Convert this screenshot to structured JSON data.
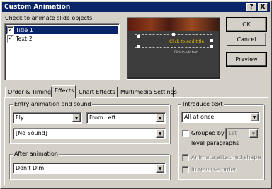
{
  "window": {
    "title": "Custom Animation"
  },
  "titlebar_buttons": {
    "help": "?",
    "close": "X"
  },
  "objects": {
    "label": "Check to animate slide objects:",
    "items": [
      {
        "label": "Title 1",
        "checked": true,
        "selected": true
      },
      {
        "label": "Text 2",
        "checked": true,
        "selected": false
      }
    ]
  },
  "preview_thumb": {
    "title_text": "Click to add title",
    "text_text": "Click to add text"
  },
  "buttons": {
    "ok": "OK",
    "cancel": "Cancel",
    "preview": "Preview"
  },
  "tabs": [
    "Order & Timing",
    "Effects",
    "Chart Effects",
    "Multimedia Settings"
  ],
  "active_tab": "Effects",
  "entry": {
    "label": "Entry animation and sound",
    "effect": "Fly",
    "direction": "From Left",
    "sound": "[No Sound]"
  },
  "after": {
    "label": "After animation",
    "value": "Don't Dim"
  },
  "introduce": {
    "label": "Introduce text",
    "value": "All at once",
    "grouped_label": "Grouped by",
    "grouped_value": "1st",
    "grouped_suffix": "level paragraphs",
    "animate_shape": "Animate attached shape",
    "reverse_order": "In reverse order"
  },
  "colors": {
    "titlebar": "#0a246a",
    "selection": "#0a246a",
    "thumb_title": "#e8c200"
  }
}
